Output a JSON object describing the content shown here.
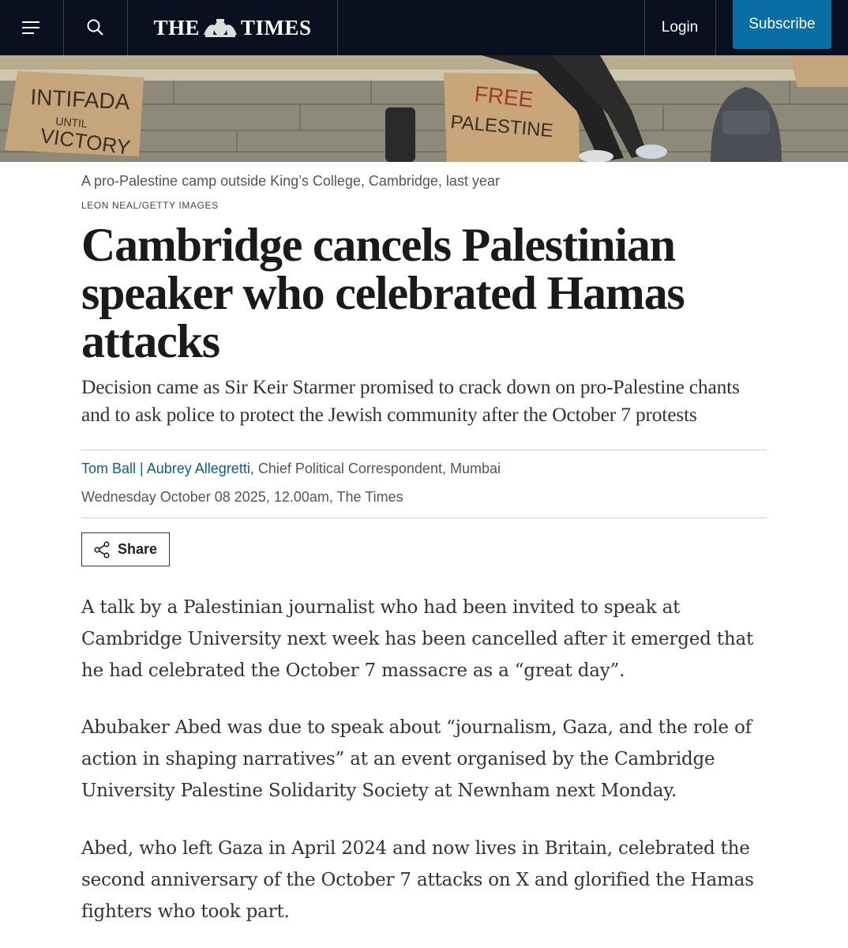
{
  "header": {
    "logo_left": "THE",
    "logo_right": "TIMES",
    "login_label": "Login",
    "subscribe_label": "Subscribe"
  },
  "hero": {
    "sign_left_line1": "INTIFADA",
    "sign_left_line2": "UNTIL",
    "sign_left_line3": "VICTORY",
    "sign_right_line1": "FREE",
    "sign_right_line2": "PALESTINE"
  },
  "image_caption": "A pro-Palestine camp outside King’s College, Cambridge, last year",
  "image_credit": "LEON NEAL/GETTY IMAGES",
  "article": {
    "headline": "Cambridge cancels Palestinian speaker who celebrated Hamas attacks",
    "standfirst": "Decision came as Sir Keir Starmer promised to crack down on pro-Palestine chants and to ask police to protect the Jewish community after the October 7 protests",
    "author1": "Tom Ball",
    "author_separator": "|",
    "author2": "Aubrey Allegretti",
    "author2_role": ", Chief Political Correspondent, Mumbai",
    "dateline": "Wednesday October 08 2025, 12.00am, The Times",
    "share_label": "Share",
    "paragraphs": [
      "A talk by a Palestinian journalist who had been invited to speak at Cambridge University next week has been cancelled after it emerged that he had celebrated the October 7 massacre as a “great day”.",
      "Abubaker Abed was due to speak about “journalism, Gaza, and the role of action in shaping narratives” at an event organised by the Cambridge University Palestine Solidarity Society at Newnham next Monday.",
      "Abed, who left Gaza in April 2024 and now lives in Britain, celebrated the second anniversary of the October 7 attacks on X and glorified the Hamas fighters who took part."
    ]
  },
  "icons": {
    "menu": "hamburger-icon",
    "search": "search-icon",
    "crest": "royal-crest-icon",
    "share": "share-icon"
  },
  "colors": {
    "topbar_bg": "#0b1020",
    "subscribe_bg": "#0a6ea4",
    "author_link": "#0a5f8f"
  }
}
